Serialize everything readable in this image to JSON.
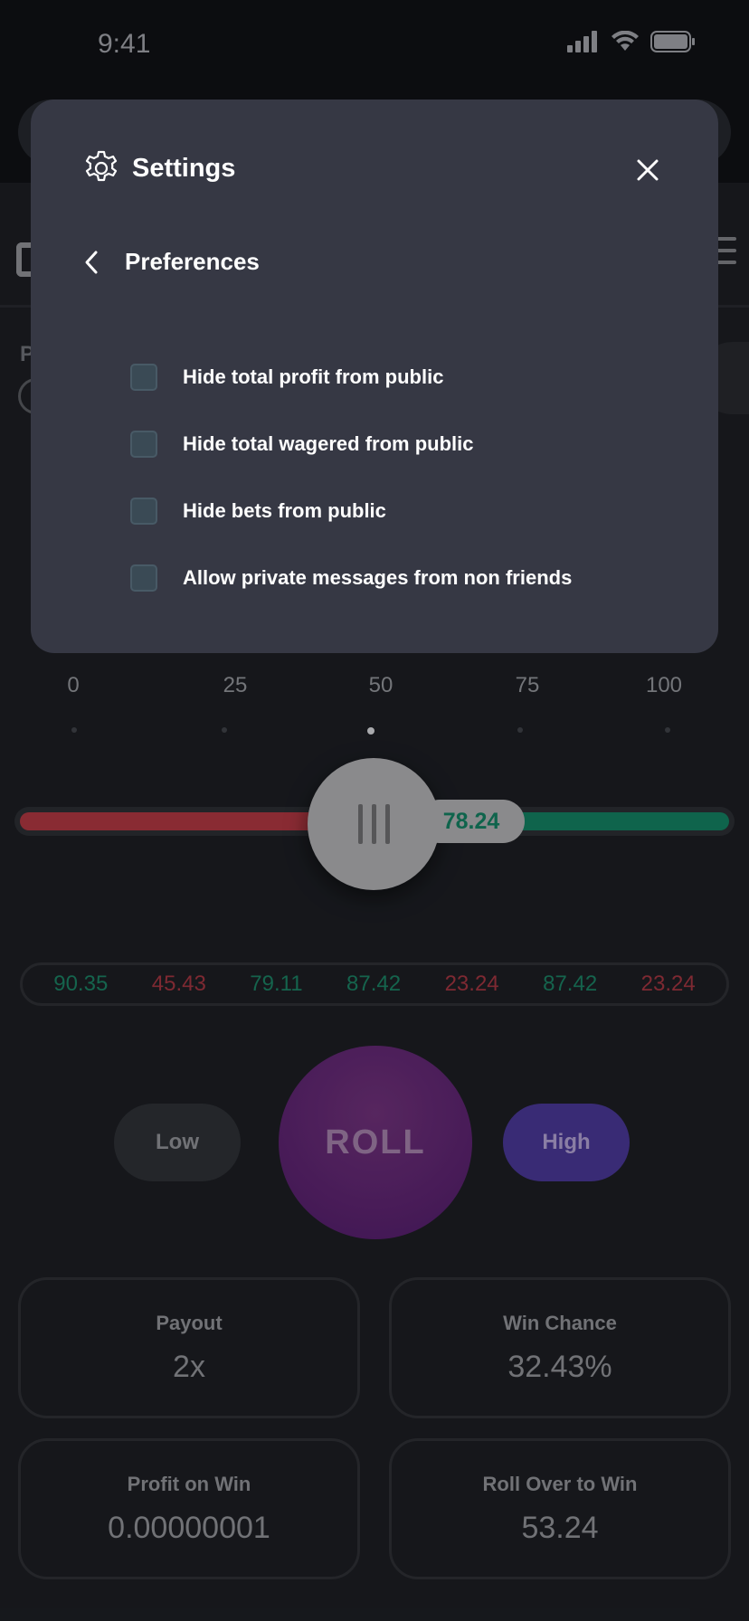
{
  "status_bar": {
    "time": "9:41"
  },
  "background": {
    "nav_letter": "P"
  },
  "scale": {
    "labels": [
      "0",
      "25",
      "50",
      "75",
      "100"
    ]
  },
  "slider": {
    "value": "78.24",
    "value_fraction": 0.5
  },
  "history": [
    {
      "value": "90.35",
      "result": "win"
    },
    {
      "value": "45.43",
      "result": "loss"
    },
    {
      "value": "79.11",
      "result": "win"
    },
    {
      "value": "87.42",
      "result": "win"
    },
    {
      "value": "23.24",
      "result": "loss"
    },
    {
      "value": "87.42",
      "result": "win"
    },
    {
      "value": "23.24",
      "result": "loss"
    }
  ],
  "buttons": {
    "low": "Low",
    "roll": "ROLL",
    "high": "High"
  },
  "stats": {
    "payout": {
      "label": "Payout",
      "value": "2x"
    },
    "win_chance": {
      "label": "Win Chance",
      "value": "32.43%"
    },
    "profit_on_win": {
      "label": "Profit on Win",
      "value": "0.00000001"
    },
    "roll_over": {
      "label": "Roll Over to Win",
      "value": "53.24"
    }
  },
  "modal": {
    "title": "Settings",
    "subtitle": "Preferences",
    "options": [
      {
        "label": "Hide total profit from public",
        "checked": false
      },
      {
        "label": "Hide total wagered from public",
        "checked": false
      },
      {
        "label": "Hide bets from public",
        "checked": false
      },
      {
        "label": "Allow private messages from non friends",
        "checked": false
      }
    ]
  },
  "colors": {
    "win": "#1a7a5e",
    "loss": "#9a333d",
    "modal_bg": "#363844",
    "roll": "#5a2470",
    "high": "#46358f"
  }
}
